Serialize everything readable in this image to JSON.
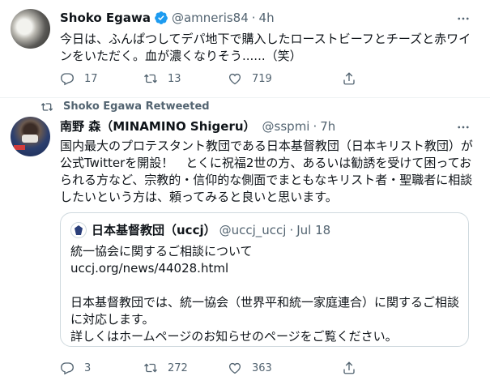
{
  "tweet1": {
    "author_name": "Shoko Egawa",
    "handle": "@amneris84",
    "separator": "·",
    "time": "4h",
    "text": "今日は、ふんぱつしてデパ地下で購入したローストビーフとチーズと赤ワインをいただく。血が濃くなりそう......（笑）",
    "replies": "17",
    "retweets": "13",
    "likes": "719",
    "avatar_icon": "cat-photo-avatar",
    "verified_icon": "verified-badge-icon"
  },
  "retweet_context": {
    "label": "Shoko Egawa Retweeted",
    "icon": "retweet-icon"
  },
  "tweet2": {
    "author_name": "南野 森（MINAMINO Shigeru）",
    "handle": "@sspmi",
    "separator": "·",
    "time": "7h",
    "text": "国内最大のプロテスタント教団である日本基督教団（日本キリスト教団）が公式Twitterを開設！　とくに祝福2世の方、あるいは勧誘を受けて困っておられる方など、宗教的・信仰的な側面でまともなキリスト者・聖職者に相談したいという方は、頼ってみると良いと思います。",
    "replies": "3",
    "retweets": "272",
    "likes": "363",
    "quote": {
      "author_name": "日本基督教団（uccj）",
      "handle": "@uccj_uccj",
      "separator": "·",
      "date": "Jul 18",
      "text": "統一協会に関するご相談について\nuccj.org/news/44028.html\n\n日本基督教団では、統一協会（世界平和統一家庭連合）に関するご相談に対応します。\n詳しくはホームページのお知らせのページをご覧ください。"
    }
  },
  "colors": {
    "text": "#0f1419",
    "secondary": "#536471",
    "border": "#cfd9de",
    "verified": "#1d9bf0"
  }
}
